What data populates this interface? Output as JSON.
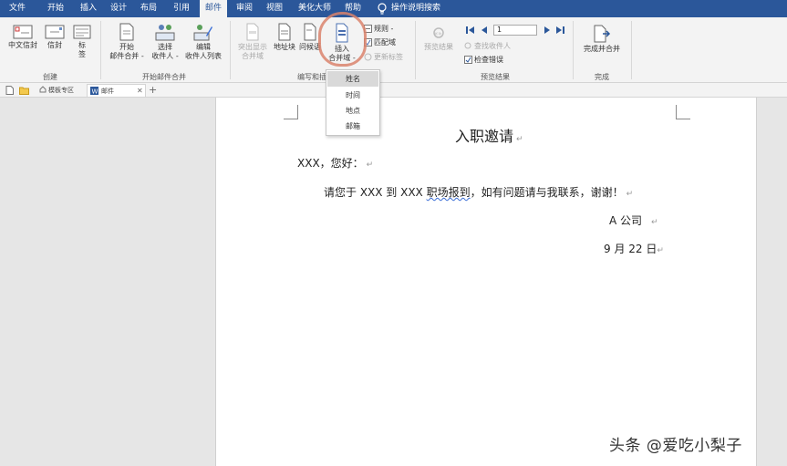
{
  "tabs": [
    "文件",
    "开始",
    "插入",
    "设计",
    "布局",
    "引用",
    "邮件",
    "审阅",
    "视图",
    "美化大师",
    "帮助"
  ],
  "active_tab": "邮件",
  "tell_me": "操作说明搜索",
  "ribbon": {
    "create": {
      "cn_envelope": "中文信封",
      "envelope": "信封",
      "label_line1": "标",
      "label_line2": "签",
      "group": "创建"
    },
    "start_merge": {
      "start_line1": "开始",
      "start_line2": "邮件合并 -",
      "select_line1": "选择",
      "select_line2": "收件人 -",
      "edit_line1": "编辑",
      "edit_line2": "收件人列表",
      "group": "开始邮件合并"
    },
    "write_insert": {
      "highlight_line1": "突出显示",
      "highlight_line2": "合并域",
      "address_block": "地址块",
      "greeting_line": "问候语",
      "insert_line1": "插入",
      "insert_line2": "合并域 -",
      "rules": "规则 -",
      "match_fields": "匹配域",
      "update_labels": "更新标签",
      "group": "编写和插"
    },
    "preview": {
      "preview_results": "预览结果",
      "find_recipient": "查找收件人",
      "check_errors": "检查错误",
      "record_value": "1",
      "group": "预览结果"
    },
    "finish": {
      "finish_merge": "完成并合并",
      "group": "完成"
    }
  },
  "doc_tabs": {
    "template_zone": "模板专区",
    "document": "邮件",
    "add": "+"
  },
  "dropdown": {
    "items": [
      "姓名",
      "时间",
      "地点",
      "邮箱"
    ],
    "highlighted": "姓名"
  },
  "document": {
    "title": "入职邀请",
    "greeting": "XXX，您好：",
    "body_pre": "请您于 XXX 到 XXX ",
    "body_wavy": "职场报到",
    "body_post": "，如有问题请与我联系，谢谢！",
    "company": "A 公司",
    "date": "9 月 22 日",
    "para_mark": "↵"
  },
  "watermark": "头条 @爱吃小梨子",
  "colors": {
    "tab_bar": "#2b579a",
    "ribbon": "#f3f3f3",
    "annotation_ring": "#d9826c"
  }
}
